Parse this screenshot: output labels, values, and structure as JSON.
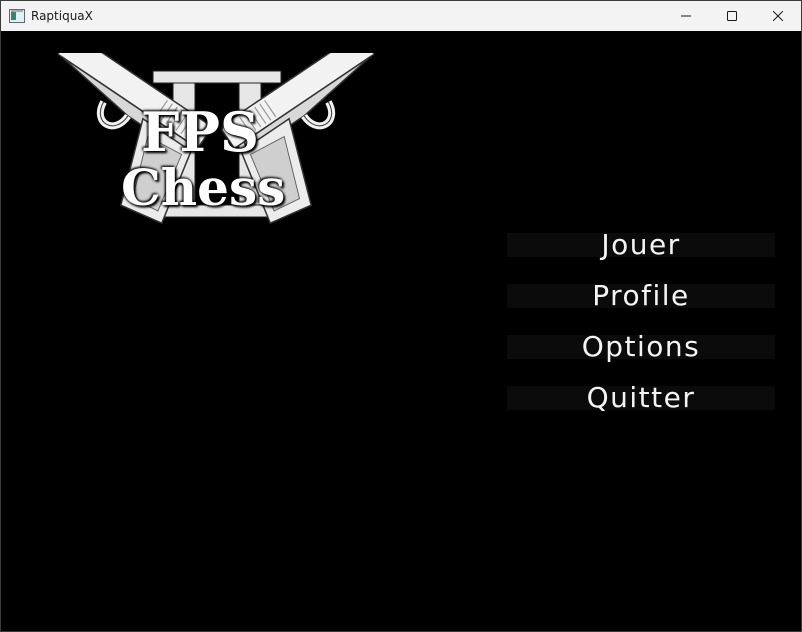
{
  "window": {
    "title": "RaptiquaX",
    "app_icon": "app-window-icon",
    "controls": [
      "minimize-icon",
      "maximize-icon",
      "close-icon"
    ]
  },
  "logo": {
    "numeral": "II",
    "line1": "FPS",
    "line2": "Chess",
    "icons": [
      "pistol-left-icon",
      "pistol-right-icon"
    ]
  },
  "menu": {
    "items": [
      {
        "label": "Jouer"
      },
      {
        "label": "Profile"
      },
      {
        "label": "Options"
      },
      {
        "label": "Quitter"
      }
    ]
  },
  "colors": {
    "background": "#000000",
    "titlebar": "#f3f3f3",
    "menu_button": "#0b0b0b",
    "menu_text": "#f4f4f4"
  }
}
